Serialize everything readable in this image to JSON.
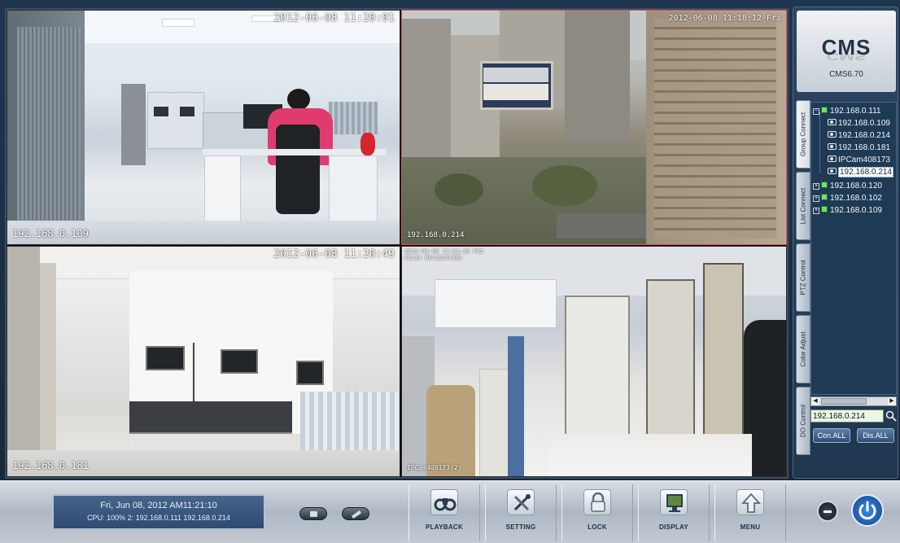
{
  "app": {
    "logo": "CMS",
    "version": "CMS6.70",
    "accent_color": "#2a5d9a"
  },
  "cameras": [
    {
      "id": "cam1",
      "timestamp": "2012-06-08 11:20:01",
      "ip": "192.168.0.109",
      "selected": false
    },
    {
      "id": "cam2",
      "timestamp": "2012-06-08 11:18:12 Fri",
      "ip": "192.168.0.214",
      "selected": true
    },
    {
      "id": "cam3",
      "timestamp": "2012-06-08 11:20:49",
      "ip": "192.168.0.181",
      "selected": false
    },
    {
      "id": "cam4",
      "osd_line1": "2012-06-08 11:21:10 FRI",
      "osd_line2": "FR=24 BR=1024(kB)",
      "ip": "IPCam408173(2)",
      "selected": false
    }
  ],
  "side_tabs": [
    "Group Connect",
    "List Connect",
    "PTZ Control",
    "Color Adjust",
    "DO Control"
  ],
  "tree": {
    "root": "192.168.0.111",
    "children": [
      "192.168.0.109",
      "192.168.0.214",
      "192.168.0.181",
      "IPCam408173",
      "192.168.0.214"
    ],
    "selected_child_index": 4,
    "others": [
      "192.168.0.120",
      "192.168.0.102",
      "192.168.0.109"
    ]
  },
  "search": {
    "value": "192.168.0.214",
    "icon": "search-icon"
  },
  "panel_buttons": {
    "connect_all": "Con.ALL",
    "disconnect_all": "Dis.ALL"
  },
  "status": {
    "datetime": "Fri, Jun 08, 2012  AM11:21:10",
    "cpu": "CPU: 100%  2: 192.168.0.111 192.168.0.214"
  },
  "toolbar": {
    "playback": "PLAYBACK",
    "setting": "SETTING",
    "lock": "LOCK",
    "display": "DISPLAY",
    "menu": "MENU"
  }
}
